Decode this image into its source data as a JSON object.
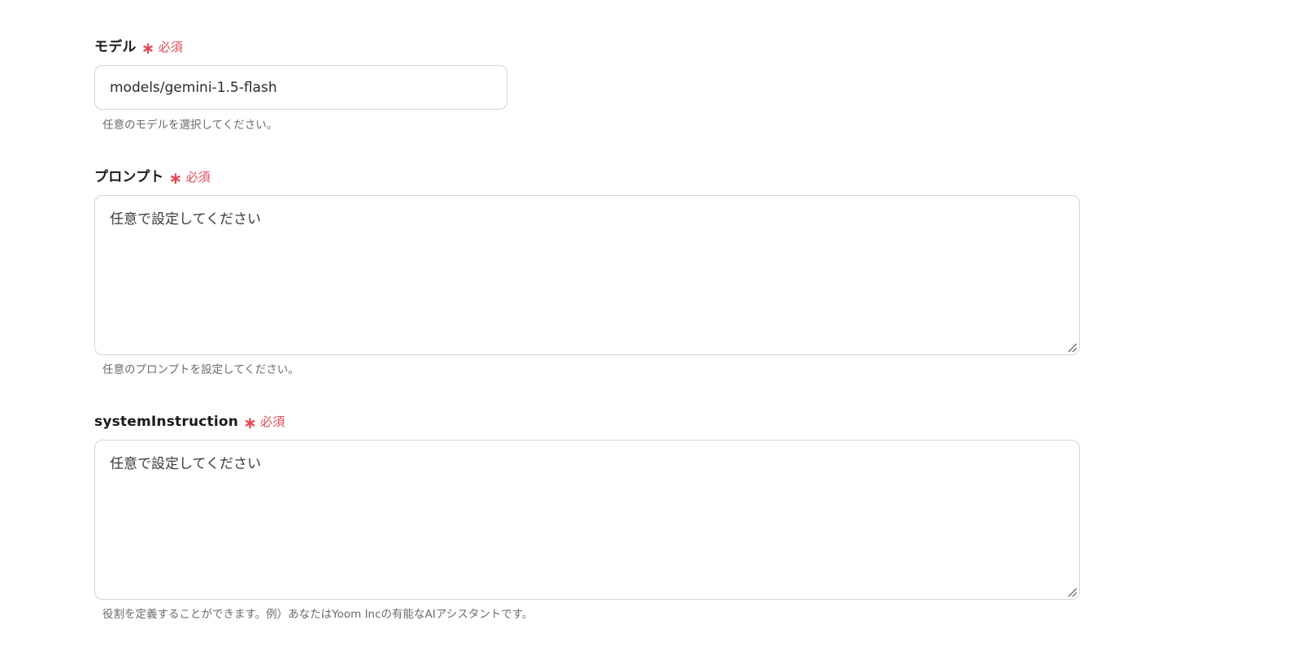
{
  "required_text": "必須",
  "required_star": "∗",
  "fields": {
    "model": {
      "label": "モデル",
      "value": "models/gemini-1.5-flash",
      "help": "任意のモデルを選択してください。"
    },
    "prompt": {
      "label": "プロンプト",
      "placeholder": "任意で設定してください",
      "help": "任意のプロンプトを設定してください。"
    },
    "system_instruction": {
      "label": "systemInstruction",
      "placeholder": "任意で設定してください",
      "help": "役割を定義することができます。例）あなたはYoom Incの有能なAIアシスタントです。"
    }
  },
  "icons": {
    "resize": "resize-grip-icon"
  }
}
